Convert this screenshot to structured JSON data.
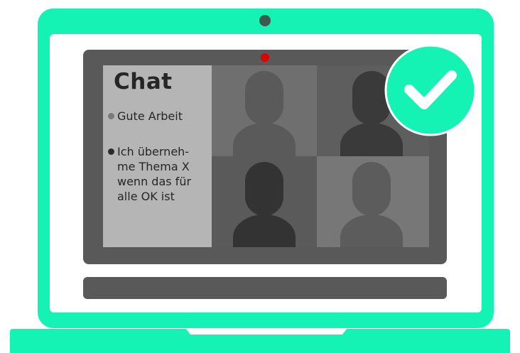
{
  "chat": {
    "title": "Chat",
    "messages": [
      {
        "text": "Gute Arbeit",
        "bullet": "light"
      },
      {
        "text": "Ich überneh-\nme Thema X\nwenn das für\nalle OK ist",
        "bullet": "dark"
      }
    ]
  },
  "participants": [
    {
      "tile_color": "#6f6f6f",
      "avatar_color": "#5a5a5a"
    },
    {
      "tile_color": "#5e5e5e",
      "avatar_color": "#3a3a3a"
    },
    {
      "tile_color": "#5a5a5a",
      "avatar_color": "#333333"
    },
    {
      "tile_color": "#777777",
      "avatar_color": "#5c5c5c"
    }
  ],
  "colors": {
    "frame_green": "#14f2b4",
    "screen_bezel": "#595959",
    "chat_background": "#b5b5b5",
    "recording_light": "#e00000",
    "checkmark_badge": "#14f2b4"
  },
  "icons": [
    "camera-icon",
    "recording-indicator-icon",
    "checkmark-icon",
    "person-icon"
  ]
}
